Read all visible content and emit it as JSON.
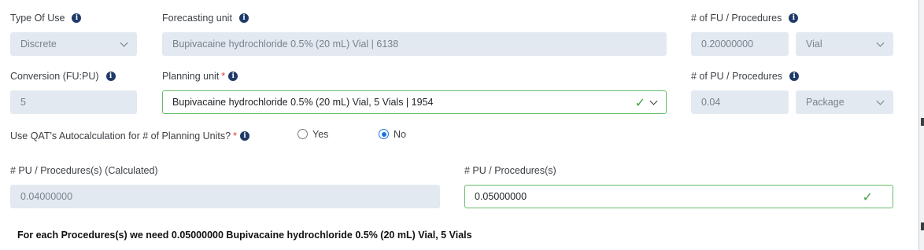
{
  "row1": {
    "type_of_use": {
      "label": "Type Of Use",
      "value": "Discrete"
    },
    "forecasting_unit": {
      "label": "Forecasting unit",
      "value": "Bupivacaine hydrochloride 0.5% (20 mL) Vial | 6138"
    },
    "fu_per_procedure": {
      "label": "# of FU / Procedures",
      "value": "0.20000000",
      "unit": "Vial"
    }
  },
  "row2": {
    "conversion": {
      "label": "Conversion (FU:PU)",
      "value": "5"
    },
    "planning_unit": {
      "label": "Planning unit",
      "required_mark": "*",
      "value": "Bupivacaine hydrochloride 0.5% (20 mL) Vial, 5 Vials | 1954"
    },
    "pu_per_procedure": {
      "label": "# of PU / Procedures",
      "value": "0.04",
      "unit": "Package"
    }
  },
  "autocalc": {
    "label": "Use QAT's Autocalculation for # of Planning Units?",
    "required_mark": "*",
    "options": [
      "Yes",
      "No"
    ],
    "selected": "No"
  },
  "calc": {
    "calculated": {
      "label": "# PU / Procedures(s) (Calculated)",
      "value": "0.04000000"
    },
    "manual": {
      "label": "# PU / Procedures(s)",
      "value": "0.05000000"
    }
  },
  "summary": "For each Procedures(s) we need 0.05000000 Bupivacaine hydrochloride 0.5% (20 mL) Vial, 5 Vials",
  "icons": {
    "info": "info-circle-icon",
    "valid": "check-icon",
    "dropdown": "chevron-down-icon",
    "info_glyph": "i",
    "check_glyph": "✓"
  },
  "colors": {
    "disabled_bg": "#e3e9f1",
    "valid_border": "#66bb6a",
    "radio_accent": "#1a73e8",
    "required": "#e53935",
    "info_icon": "#1f3a68"
  }
}
